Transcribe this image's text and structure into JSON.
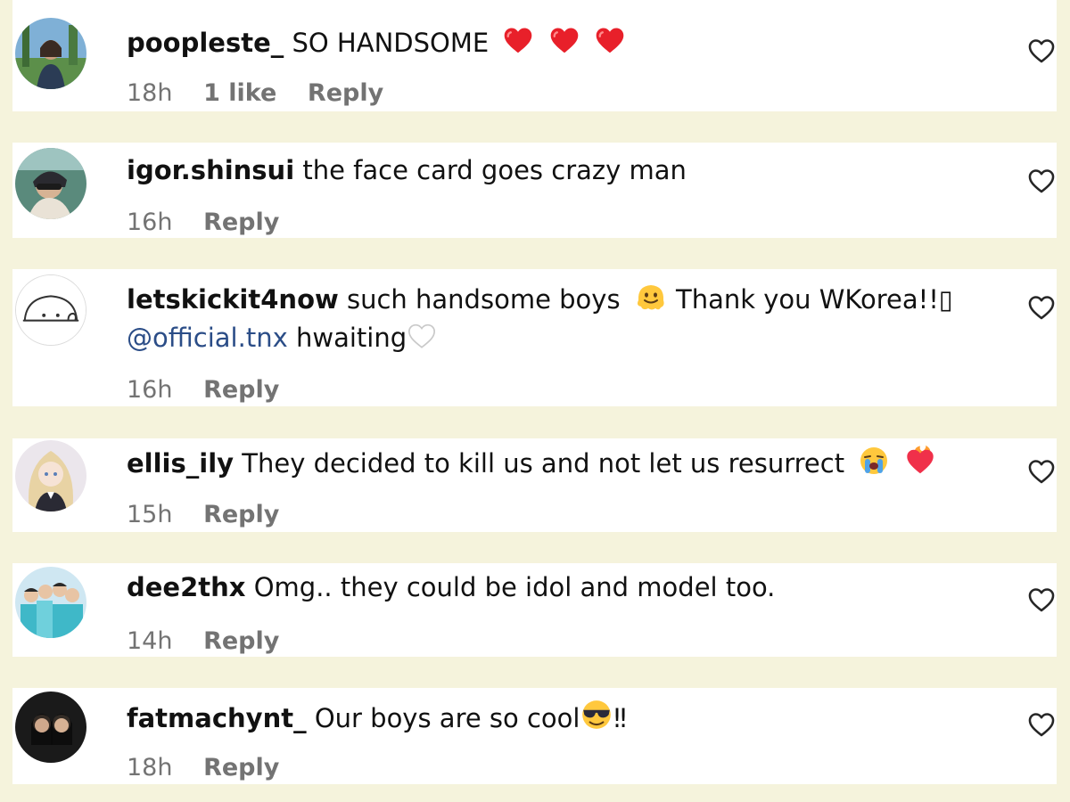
{
  "comments": [
    {
      "username": "poopleste_",
      "text": "SO HANDSOME",
      "emojis": [
        "red-heart",
        "red-heart",
        "red-heart"
      ],
      "time": "18h",
      "likes": "1 like",
      "reply_label": "Reply"
    },
    {
      "username": "igor.shinsui",
      "text": "the face card goes crazy man",
      "time": "16h",
      "reply_label": "Reply"
    },
    {
      "username": "letskickit4now",
      "text_part1": "such handsome boys",
      "text_part2": "Thank you WKorea!!▯",
      "mention": "@official.tnx",
      "text_line2": "hwaiting",
      "emojis": [
        "melting-face",
        "white-heart"
      ],
      "time": "16h",
      "reply_label": "Reply"
    },
    {
      "username": "ellis_ily",
      "text": "They decided to kill us and not let us resurrect",
      "emojis": [
        "loudly-crying-face",
        "heart-on-fire"
      ],
      "time": "15h",
      "reply_label": "Reply"
    },
    {
      "username": "dee2thx",
      "text": "Omg.. they could be idol and model too.",
      "time": "14h",
      "reply_label": "Reply"
    },
    {
      "username": "fatmachynt_",
      "text": "Our boys are so cool",
      "text_after": "‼",
      "emojis": [
        "smiling-face-with-sunglasses"
      ],
      "time": "18h",
      "reply_label": "Reply"
    }
  ],
  "colors": {
    "page_background": "#f5f3dc",
    "card_background": "#ffffff",
    "text": "#111111",
    "meta_text": "#737373",
    "mention": "#2b4d87"
  },
  "icons": {
    "like_button": "heart-outline-icon"
  }
}
